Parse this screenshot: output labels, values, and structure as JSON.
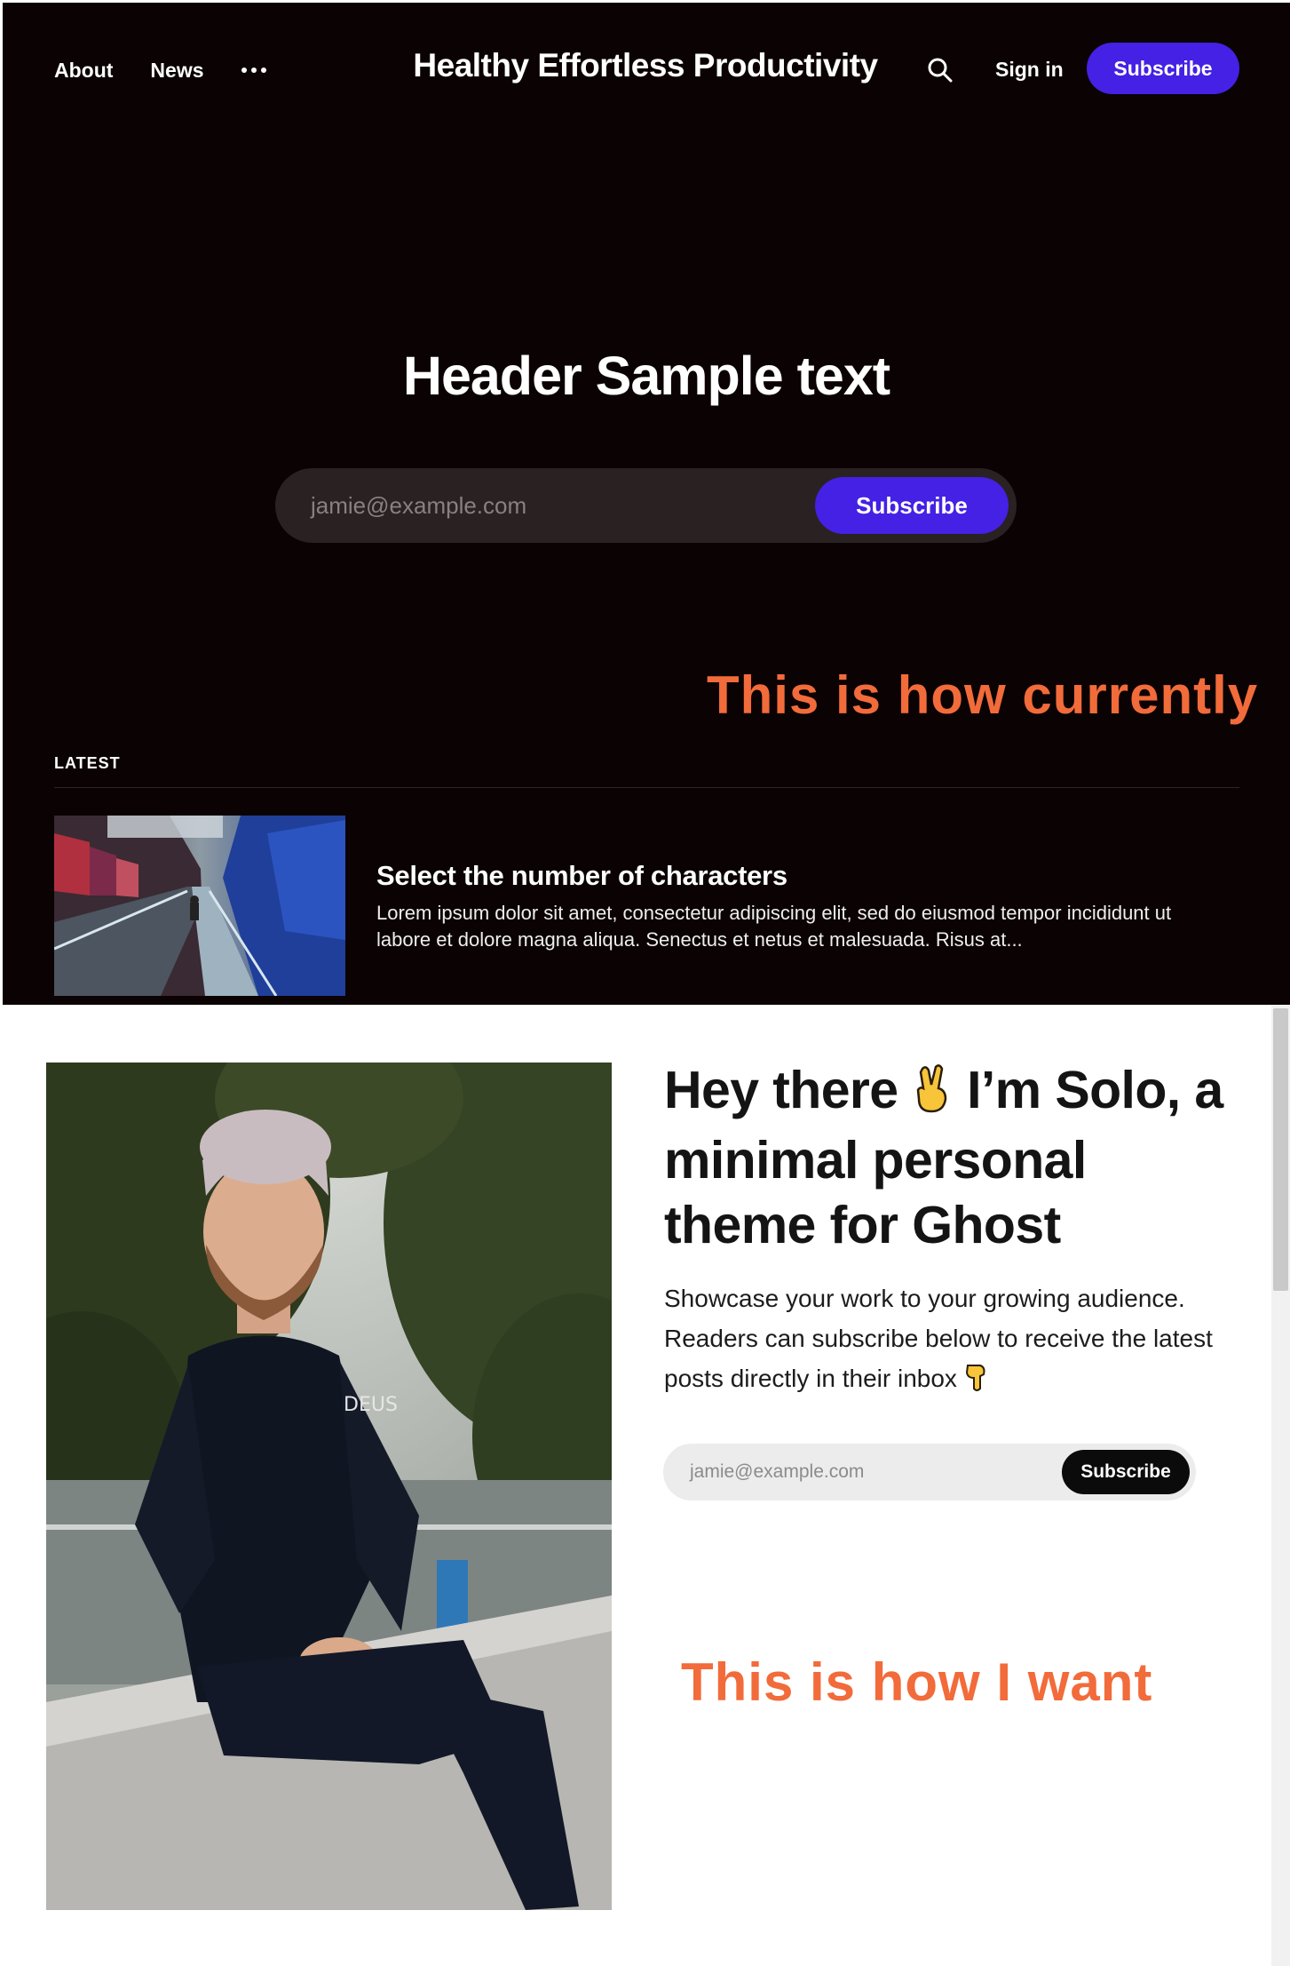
{
  "current": {
    "nav": {
      "about": "About",
      "news": "News",
      "more_icon": "ellipsis-icon",
      "site_title": "Healthy Effortless Productivity",
      "search_icon": "search-icon",
      "sign_in": "Sign in",
      "subscribe": "Subscribe"
    },
    "hero": {
      "title": "Header Sample text",
      "email_placeholder": "jamie@example.com",
      "subscribe": "Subscribe"
    },
    "annotation": "This is how currently",
    "latest": {
      "label": "LATEST",
      "post": {
        "title": "Select the number of characters",
        "excerpt": "Lorem ipsum dolor sit amet, consectetur adipiscing elit, sed do eiusmod tempor incididunt ut labore et dolore magna aliqua. Senectus et netus et malesuada. Risus at..."
      }
    }
  },
  "desired": {
    "heading_part1": "Hey there",
    "heading_emoji": "victory-hand-emoji",
    "heading_part2": "I’m Solo, a minimal personal theme for Ghost",
    "body": "Showcase your work to your growing audience. Readers can subscribe below to receive the latest posts directly in their inbox",
    "body_emoji": "pointing-down-emoji",
    "email_placeholder": "jamie@example.com",
    "subscribe": "Subscribe",
    "annotation": "This is how I want"
  },
  "colors": {
    "dark_bg": "#0b0203",
    "accent": "#4421e4",
    "annotation": "#f26b3a"
  }
}
